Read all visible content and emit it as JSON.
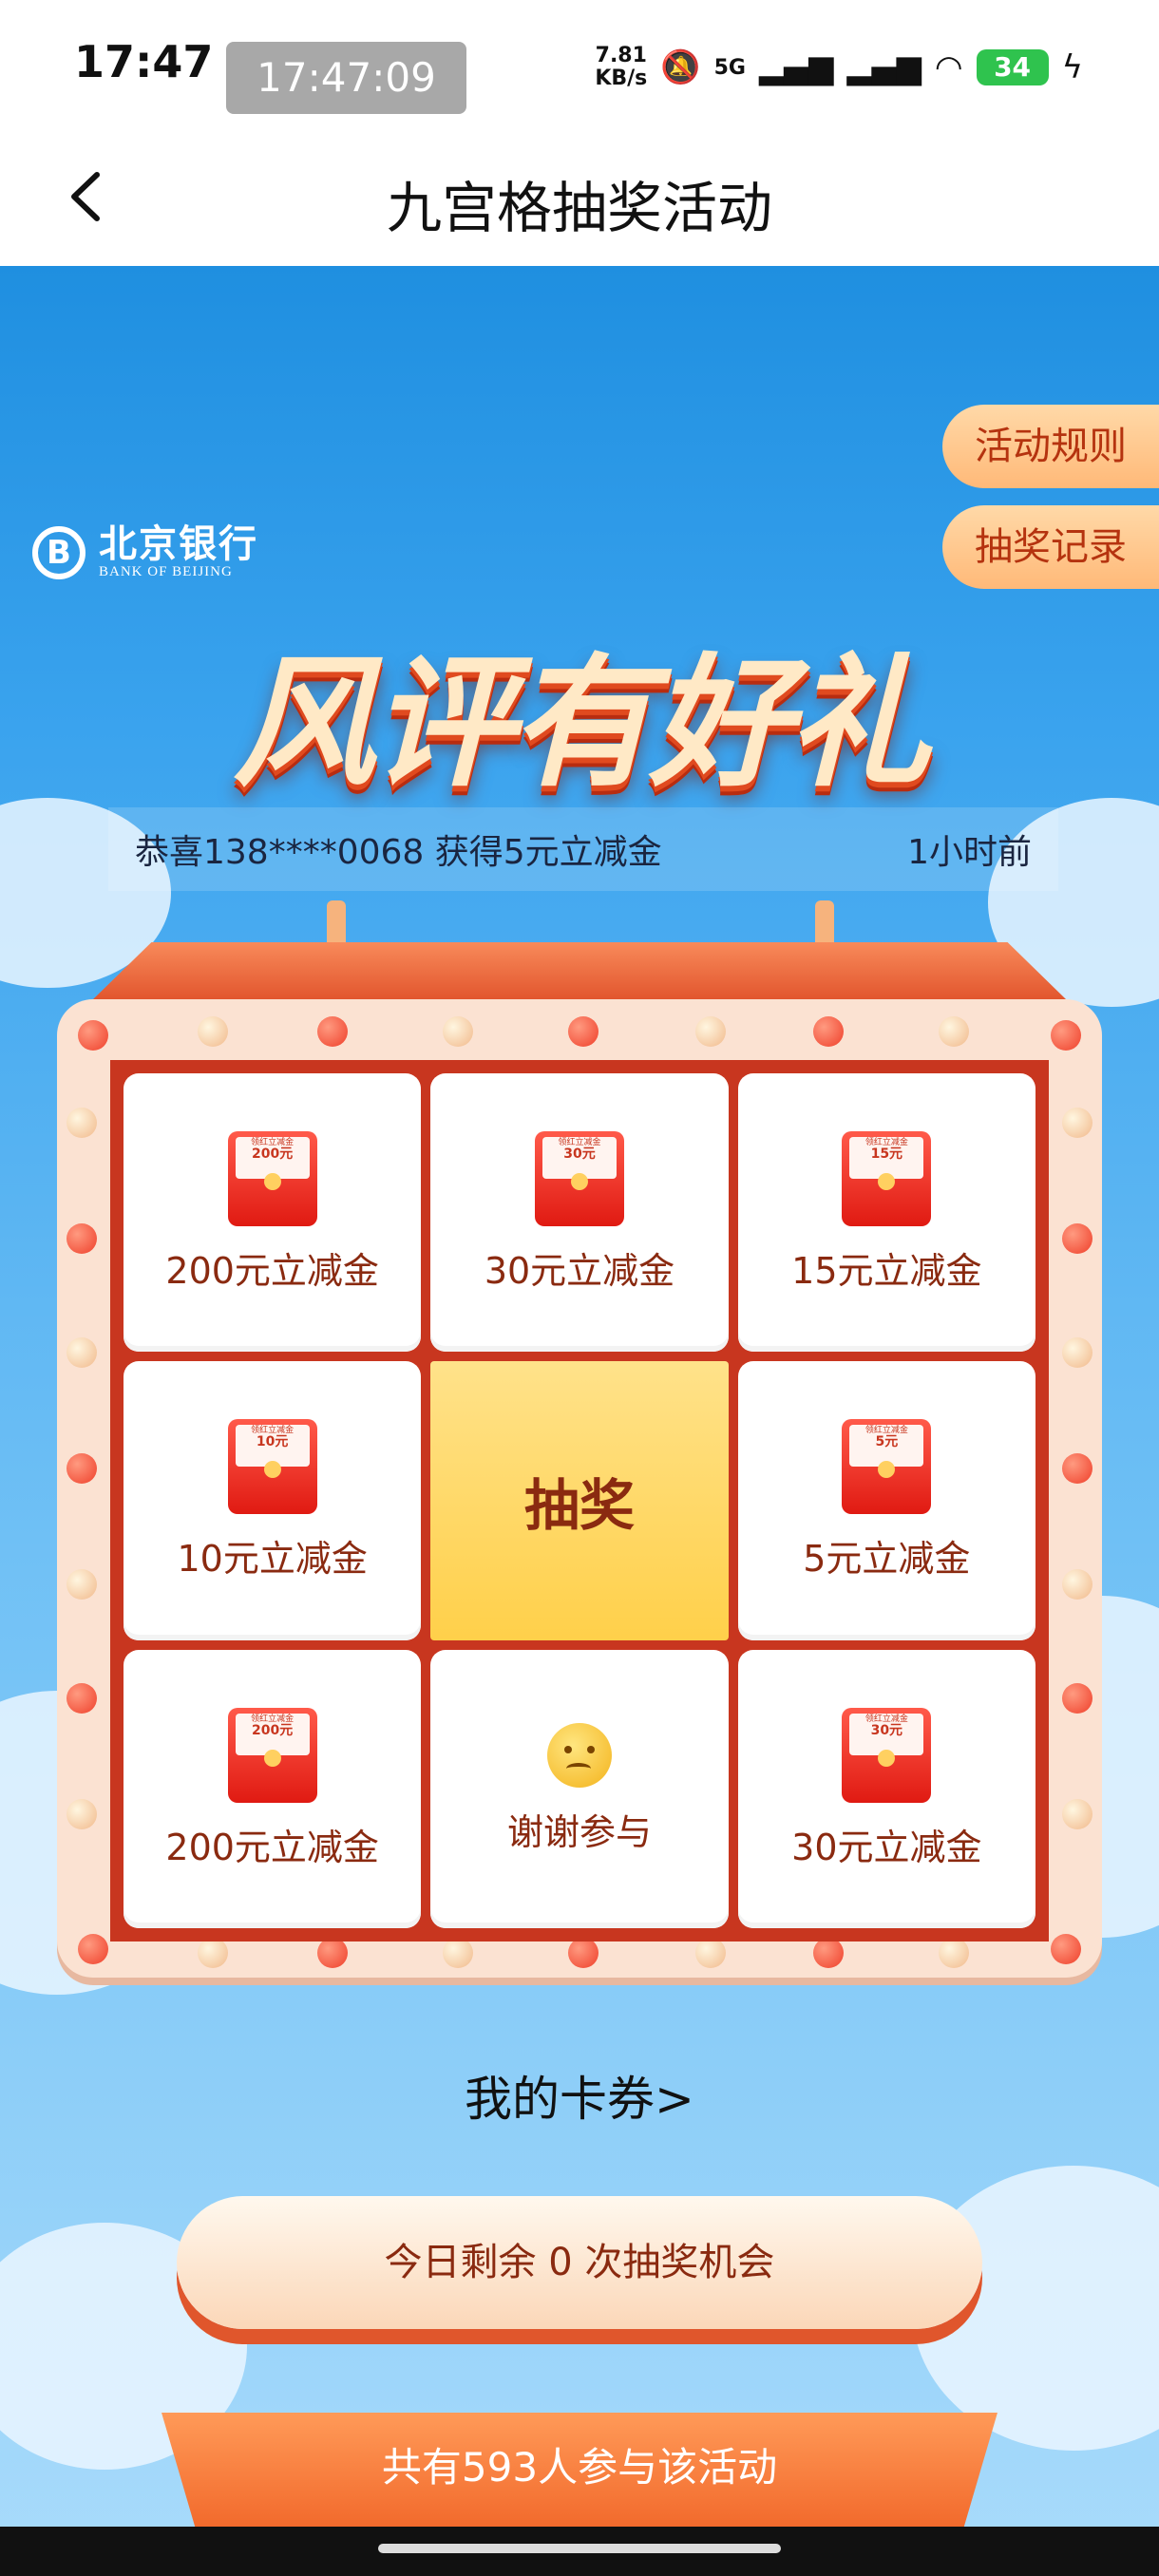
{
  "status_bar": {
    "time": "17:47",
    "recording_time": "17:47:09",
    "net_speed_value": "7.81",
    "net_speed_unit": "KB/s",
    "network": "5G",
    "battery": "34"
  },
  "nav": {
    "title": "九宫格抽奖活动"
  },
  "side_buttons": {
    "rules": "活动规则",
    "records": "抽奖记录"
  },
  "logo": {
    "cn": "北京银行",
    "en": "BANK OF BEIJING",
    "mark": "B"
  },
  "banner": {
    "headline": "风评有好礼"
  },
  "ticker": {
    "message": "恭喜138****0068 获得5元立减金",
    "time": "1小时前"
  },
  "grid": {
    "cells": [
      {
        "type": "coupon",
        "amount": "200",
        "label": "200元立减金"
      },
      {
        "type": "coupon",
        "amount": "30",
        "label": "30元立减金"
      },
      {
        "type": "coupon",
        "amount": "15",
        "label": "15元立减金"
      },
      {
        "type": "coupon",
        "amount": "10",
        "label": "10元立减金"
      },
      {
        "type": "draw",
        "label": "抽奖"
      },
      {
        "type": "coupon",
        "amount": "5",
        "label": "5元立减金"
      },
      {
        "type": "coupon",
        "amount": "200",
        "label": "200元立减金"
      },
      {
        "type": "none",
        "label": "谢谢参与"
      },
      {
        "type": "coupon",
        "amount": "30",
        "label": "30元立减金"
      }
    ],
    "coupon_card_text": "领红立减金",
    "coupon_unit": "元"
  },
  "my_coupons": "我的卡券>",
  "chance_text": "今日剩余 0 次抽奖机会",
  "participants_text": "共有593人参与该活动",
  "colors": {
    "primary_red": "#c8361f",
    "draw_yellow": "#ffd04a",
    "sky_blue": "#2e9ae6"
  }
}
